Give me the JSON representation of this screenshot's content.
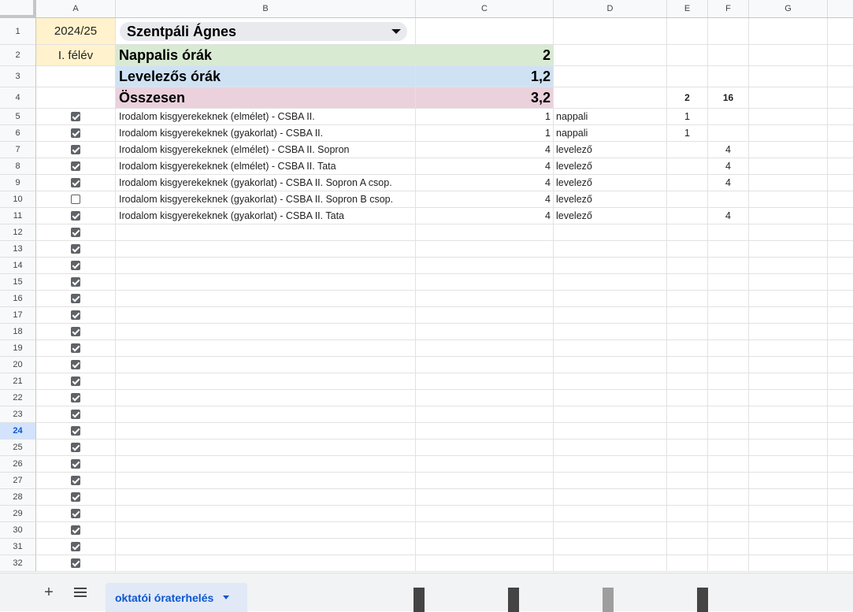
{
  "columns": [
    "A",
    "B",
    "C",
    "D",
    "E",
    "F",
    "G"
  ],
  "row1": {
    "num": "1",
    "a": "2024/25",
    "dropdown": "Szentpáli Ágnes"
  },
  "row2": {
    "num": "2",
    "a": "I. félév",
    "b": "Nappalis órák",
    "c": "2"
  },
  "row3": {
    "num": "3",
    "b": "Levelezős órák",
    "c": "1,2"
  },
  "row4": {
    "num": "4",
    "b": "Összesen",
    "c": "3,2",
    "e": "2",
    "f": "16"
  },
  "rows": [
    {
      "num": "5",
      "b": "Irodalom kisgyerekeknek (elmélet) - CSBA II.",
      "c": "1",
      "d": "nappali",
      "e": "1",
      "f": ""
    },
    {
      "num": "6",
      "b": "Irodalom kisgyerekeknek (gyakorlat) - CSBA II.",
      "c": "1",
      "d": "nappali",
      "e": "1",
      "f": ""
    },
    {
      "num": "7",
      "b": "Irodalom kisgyerekeknek (elmélet) - CSBA II. Sopron",
      "c": "4",
      "d": "levelező",
      "e": "",
      "f": "4"
    },
    {
      "num": "8",
      "b": "Irodalom kisgyerekeknek (elmélet) - CSBA II. Tata",
      "c": "4",
      "d": "levelező",
      "e": "",
      "f": "4"
    },
    {
      "num": "9",
      "b": "Irodalom kisgyerekeknek (gyakorlat) - CSBA II. Sopron A csop.",
      "c": "4",
      "d": "levelező",
      "e": "",
      "f": "4"
    },
    {
      "num": "10",
      "b": "Irodalom kisgyerekeknek (gyakorlat) - CSBA II. Sopron B csop.",
      "c": "4",
      "d": "levelező",
      "e": "",
      "f": ""
    },
    {
      "num": "11",
      "b": "Irodalom kisgyerekeknek (gyakorlat) - CSBA II. Tata",
      "c": "4",
      "d": "levelező",
      "e": "",
      "f": "4"
    }
  ],
  "checkboxes": {
    "5": true,
    "6": true,
    "7": true,
    "8": true,
    "9": true,
    "10": false,
    "11": true
  },
  "empty_rows": [
    "12",
    "13",
    "14",
    "15",
    "16",
    "17",
    "18",
    "19",
    "20",
    "21",
    "22",
    "23",
    "24",
    "25",
    "26",
    "27",
    "28",
    "29",
    "30",
    "31",
    "32"
  ],
  "selected_row": "24",
  "colors": {
    "yellow": "#fff2cc",
    "green": "#d9ead3",
    "blue": "#cfe2f3",
    "pink": "#ead1dc"
  },
  "bottom": {
    "add_icon": "plus-icon",
    "menu_icon": "menu-icon",
    "sheet_tab": "oktatói óraterhelés"
  }
}
